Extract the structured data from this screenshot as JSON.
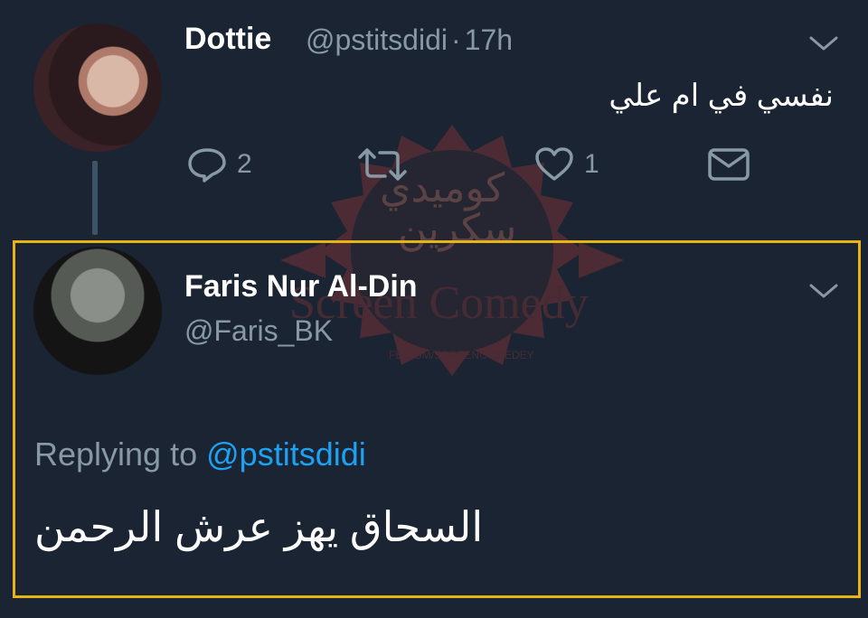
{
  "tweet": {
    "author_name": "Dottie",
    "author_handle": "@pstitsdidi",
    "separator": "·",
    "time": "17h",
    "text": "نفسي في ام علي",
    "actions": {
      "reply_count": "2",
      "retweet_count": "",
      "like_count": "1"
    }
  },
  "reply": {
    "author_name": "Faris Nur Al-Din",
    "author_handle": "@Faris_BK",
    "replying_prefix": "Replying to",
    "replying_mention": "@pstitsdidi",
    "text": "السحاق يهز عرش الرحمن"
  },
  "watermark": {
    "arabic_line1": "سكرين",
    "arabic_line2": "كوميدي",
    "brand": "Screen Comedy",
    "url": "FB.COM/SCREENCOMEDEY"
  },
  "colors": {
    "background": "#1b2432",
    "highlight_border": "#e7b416",
    "mention": "#1da1f2",
    "muted": "#8899a6"
  },
  "icons": [
    "reply-icon",
    "retweet-icon",
    "like-icon",
    "message-icon",
    "chevron-down-icon"
  ]
}
